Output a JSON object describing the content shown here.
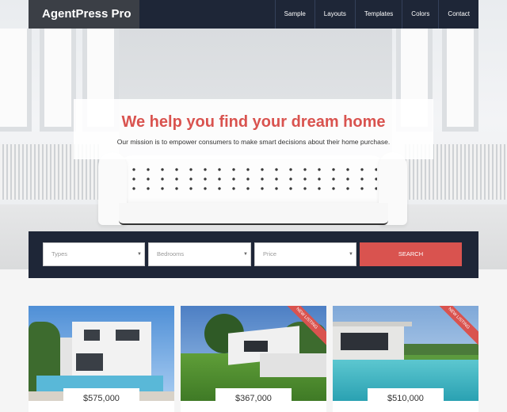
{
  "site": {
    "logo": "AgentPress Pro"
  },
  "nav": {
    "items": [
      "Sample",
      "Layouts",
      "Templates",
      "Colors",
      "Contact"
    ]
  },
  "hero": {
    "title": "We help you find your dream home",
    "subtitle": "Our mission is to empower consumers to make smart decisions about their home purchase."
  },
  "search": {
    "fields": [
      "Types",
      "Bedrooms",
      "Price"
    ],
    "button": "SEARCH"
  },
  "listings": [
    {
      "price": "$575,000",
      "ribbon": ""
    },
    {
      "price": "$367,000",
      "ribbon": "NEW LISTING"
    },
    {
      "price": "$510,000",
      "ribbon": "NEW LISTING"
    }
  ],
  "colors": {
    "accent": "#d9534f",
    "dark": "#1e2637",
    "logo_bg": "#3b3f46"
  },
  "icons": {
    "dropdown": "chevron-down-icon"
  }
}
